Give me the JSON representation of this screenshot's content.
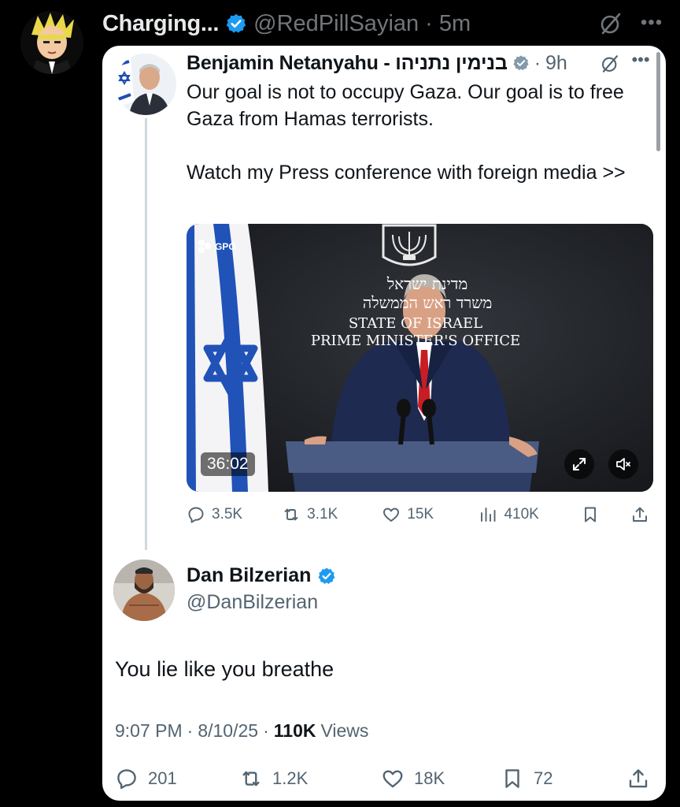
{
  "outer": {
    "name": "Charging...",
    "handle": "@RedPillSayian",
    "separator": "·",
    "time": "5m",
    "avatar_icon": "cartoon-avatar"
  },
  "ref_tweet": {
    "name": "Benjamin Netanyahu - בנימין נתניהו",
    "separator": "·",
    "time": "9h",
    "text": "Our goal is not to occupy Gaza. Our goal is to free Gaza from Hamas terrorists.\n\nWatch my Press conference with foreign media >>",
    "video": {
      "duration": "36:02",
      "watermark": "GPO",
      "sign_hebrew_1": "מדינת ישראל",
      "sign_hebrew_2": "משרד ראש הממשלה",
      "sign_english_1": "STATE OF ISRAEL",
      "sign_english_2": "PRIME MINISTER'S OFFICE"
    },
    "stats": {
      "replies": "3.5K",
      "reposts": "3.1K",
      "likes": "15K",
      "views": "410K"
    }
  },
  "main_tweet": {
    "name": "Dan Bilzerian",
    "handle": "@DanBilzerian",
    "text": "You lie like you breathe",
    "time": "9:07 PM",
    "date": "8/10/25",
    "separator": "·",
    "views_count": "110K",
    "views_label": "Views",
    "stats": {
      "replies": "201",
      "reposts": "1.2K",
      "likes": "18K",
      "bookmarks": "72"
    }
  },
  "colors": {
    "verified_blue": "#1d9bf0",
    "verified_gray": "#829aab",
    "muted_text": "#536471",
    "flag_blue": "#1f4fb0"
  }
}
